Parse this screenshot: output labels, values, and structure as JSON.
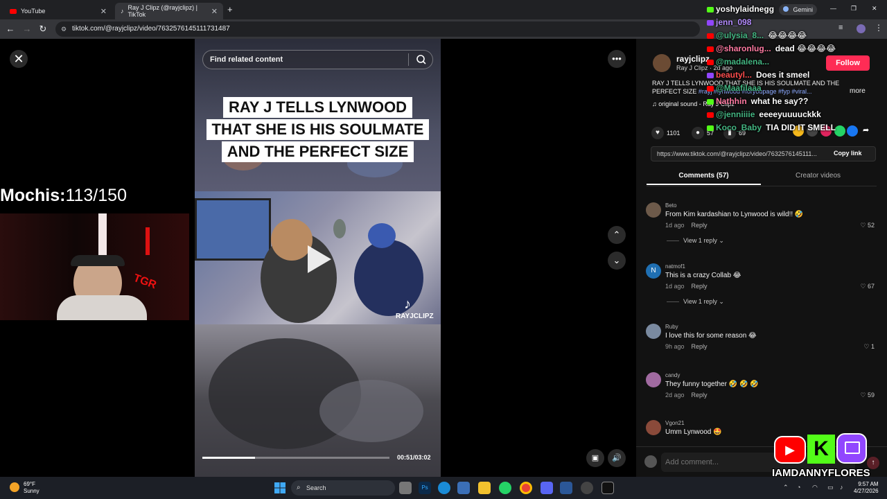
{
  "browser": {
    "tabs": [
      {
        "label": "YouTube",
        "active": false
      },
      {
        "label": "Ray J Clipz (@rayjclipz) | TikTok",
        "active": true
      }
    ],
    "new_tab": "+",
    "url": "tiktok.com/@rayjclipz/video/7632576145111731487",
    "window_controls": [
      "—",
      "❐",
      "✕"
    ],
    "profile_name": "Gemini"
  },
  "stream_overlay": {
    "counter_label": "Mochis:",
    "counter_value": "113/150",
    "brand": "IAMDANNYFLORES"
  },
  "video": {
    "search_placeholder": "Find related content",
    "caption_lines": [
      "RAY J TELLS LYNWOOD",
      "THAT SHE IS HIS SOULMATE",
      "AND THE PERFECT SIZE"
    ],
    "watermark": "RAYJCLIPZ",
    "timecode": "00:51/03:02",
    "progress_fraction": 0.28
  },
  "panel": {
    "username": "rayjclipz",
    "subline": "Ray J Clipz · 2d ago",
    "follow": "Follow",
    "description": "RAY J TELLS LYNWOOD THAT SHE IS HIS SOULMATE AND THE PERFECT SIZE",
    "tags": "#rayj #lynwood #foryoupage #fyp #viral...",
    "more": "more",
    "sound": "original sound - Ray J Clipz",
    "likes": "1101",
    "comments_count": "57",
    "saves": "69",
    "link": "https://www.tiktok.com/@rayjclipz/video/7632576145111...",
    "copy_link": "Copy link",
    "tab_comments": "Comments (57)",
    "tab_creator": "Creator videos",
    "comments": [
      {
        "user": "Beto",
        "text": "From Kim kardashian to Lynwood is wild!! 🤣",
        "time": "1d ago",
        "reply": "Reply",
        "likes": "52",
        "view_replies": "View 1 reply",
        "avatar_color": "#6d5a4a"
      },
      {
        "user": "natmof1",
        "text": "This is a crazy Collab 😂",
        "time": "1d ago",
        "reply": "Reply",
        "likes": "67",
        "view_replies": "View 1 reply",
        "avatar_color": "#1f6fb2"
      },
      {
        "user": "Ruby",
        "text": "I love this for some reason 😂",
        "time": "9h ago",
        "reply": "Reply",
        "likes": "1",
        "view_replies": "",
        "avatar_color": "#7a8aa0"
      },
      {
        "user": "candy",
        "text": "They funny together 🤣 🤣 🤣",
        "time": "2d ago",
        "reply": "Reply",
        "likes": "59",
        "view_replies": "",
        "avatar_color": "#a06aa0"
      },
      {
        "user": "Vgon21",
        "text": "Umm Lynwood 🤩",
        "time": "",
        "reply": "",
        "likes": "",
        "view_replies": "",
        "avatar_color": "#8a4a3a"
      }
    ],
    "add_comment": "Add comment..."
  },
  "chat": [
    {
      "user": "yoshylaidnegg",
      "msg": "",
      "user_color": "#ffffff",
      "platform": "kick"
    },
    {
      "user": "jenn_098",
      "msg": "",
      "user_color": "#b48cff",
      "platform": "twitch"
    },
    {
      "user": "@ulysia_8...",
      "msg": "😂😂😂😂",
      "user_color": "#43b581",
      "platform": "youtube"
    },
    {
      "user": "@sharonlug...",
      "msg": "dead 😂😂😂😂",
      "user_color": "#ff7aa2",
      "platform": "youtube"
    },
    {
      "user": "@madalena...",
      "msg": "",
      "user_color": "#43b581",
      "platform": "youtube"
    },
    {
      "user": "beautyl...",
      "msg": "Does it smeel",
      "user_color": "#ff4d4d",
      "platform": "twitch"
    },
    {
      "user": "@Maafilaaa",
      "msg": "",
      "user_color": "#43b581",
      "platform": "youtube"
    },
    {
      "user": "Nathhin",
      "msg": "what he say??",
      "user_color": "#ff7aa2",
      "platform": "kick"
    },
    {
      "user": "@jenniiiie",
      "msg": "eeeeyuuuuckkk",
      "user_color": "#43b581",
      "platform": "youtube"
    },
    {
      "user": "Koco_Baby",
      "msg": "TIA DID IT SMELL",
      "user_color": "#43b581",
      "platform": "kick"
    }
  ],
  "taskbar": {
    "weather_temp": "69°F",
    "weather_desc": "Sunny",
    "search": "Search",
    "time": "9:57 AM",
    "date": "4/27/2026"
  },
  "colors": {
    "tiktok_red": "#fe2c55",
    "panel_bg": "#121212",
    "chrome_dark": "#202124"
  }
}
